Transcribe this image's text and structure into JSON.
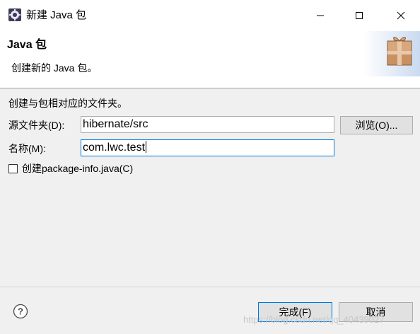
{
  "window": {
    "title": "新建 Java 包",
    "controls": {
      "minimize": "minimize",
      "maximize": "maximize",
      "close": "close"
    }
  },
  "header": {
    "title": "Java 包",
    "description": "创建新的 Java 包。"
  },
  "form": {
    "description": "创建与包相对应的文件夹。",
    "source_folder": {
      "label": "源文件夹(D):",
      "value": "hibernate/src",
      "browse_label": "浏览(O)..."
    },
    "name": {
      "label": "名称(M):",
      "value": "com.lwc.test"
    },
    "create_package_info": {
      "label": "创建package-info.java(C)",
      "checked": false
    }
  },
  "footer": {
    "finish_label": "完成(F)",
    "cancel_label": "取消",
    "help_icon": "help-icon",
    "watermark": "https://blog.csdn.net/qq_40439027"
  },
  "colors": {
    "accent": "#0078d7",
    "window_bg": "#f0f0f0",
    "banner_bg": "#ffffff"
  }
}
